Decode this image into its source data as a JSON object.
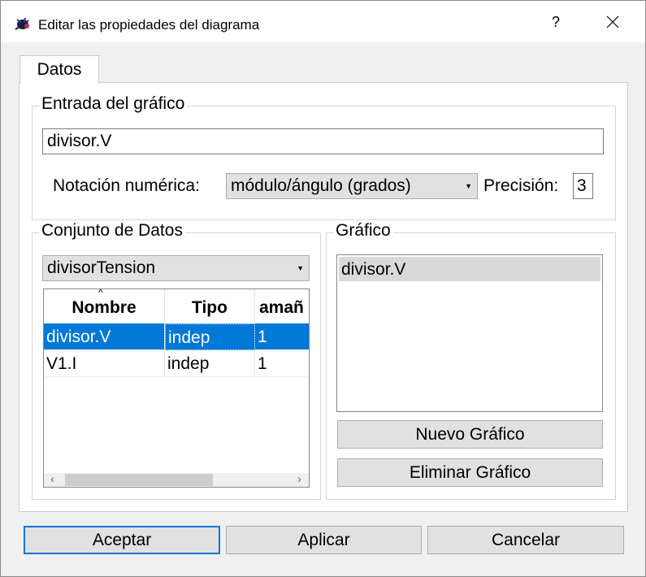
{
  "window": {
    "title": "Editar las propiedades del diagrama",
    "help_label": "?",
    "icons": {
      "app": "app-logo-icon",
      "close": "close-icon"
    }
  },
  "tabs": [
    {
      "label": "Datos",
      "active": true
    }
  ],
  "graph_input": {
    "title": "Entrada del gráfico",
    "value": "divisor.V",
    "notation_label": "Notación numérica:",
    "notation_value": "módulo/ángulo (grados)",
    "precision_label": "Precisión:",
    "precision_value": "3"
  },
  "dataset": {
    "title": "Conjunto de Datos",
    "selected": "divisorTension",
    "columns": [
      "Nombre",
      "Tipo",
      "amañ"
    ],
    "rows": [
      {
        "nombre": "divisor.V",
        "tipo": "indep",
        "tamano": "1",
        "selected": true
      },
      {
        "nombre": "V1.I",
        "tipo": "indep",
        "tamano": "1",
        "selected": false
      }
    ],
    "scroll_left": "‹",
    "scroll_right": "›"
  },
  "graph": {
    "title": "Gráfico",
    "items": [
      "divisor.V"
    ],
    "new_button": "Nuevo Gráfico",
    "delete_button": "Eliminar Gráfico"
  },
  "footer": {
    "accept": "Aceptar",
    "apply": "Aplicar",
    "cancel": "Cancelar"
  },
  "colors": {
    "selection": "#0078d7",
    "button_bg": "#e1e1e1",
    "dialog_bg": "#f0f0f0"
  }
}
